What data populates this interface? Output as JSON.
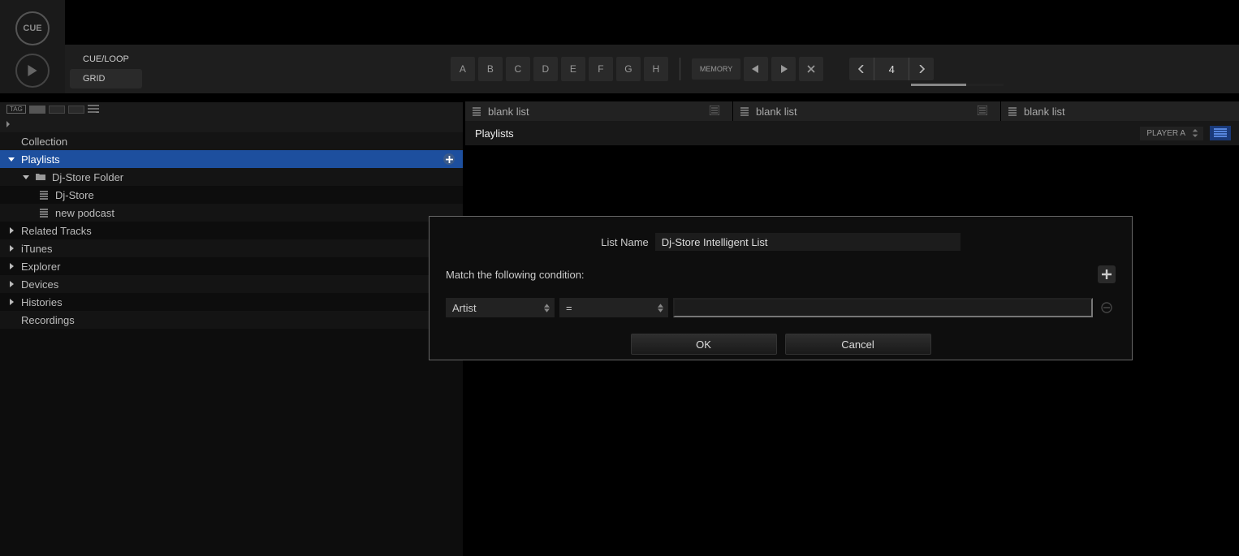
{
  "topleft": {
    "cue": "CUE"
  },
  "toolbar": {
    "tabs": {
      "cue_loop": "CUE/LOOP",
      "grid": "GRID"
    },
    "hotcues": [
      "A",
      "B",
      "C",
      "D",
      "E",
      "F",
      "G",
      "H"
    ],
    "memory_label": "MEMORY",
    "beat_count": "4"
  },
  "tagbar": {
    "tag": "TAG"
  },
  "tree": {
    "collection": "Collection",
    "playlists": "Playlists",
    "dj_store_folder": "Dj-Store Folder",
    "dj_store": "Dj-Store",
    "new_podcast": "new podcast",
    "related": "Related Tracks",
    "itunes": "iTunes",
    "explorer": "Explorer",
    "devices": "Devices",
    "histories": "Histories",
    "recordings": "Recordings"
  },
  "panels": {
    "blank1": "blank list",
    "blank2": "blank list",
    "blank3": "blank list"
  },
  "subhdr": {
    "title": "Playlists",
    "player": "PLAYER A"
  },
  "dialog": {
    "list_name_label": "List Name",
    "list_name_value": "Dj-Store Intelligent List",
    "match_label": "Match the following condition:",
    "field": "Artist",
    "op": "=",
    "value": "",
    "ok": "OK",
    "cancel": "Cancel"
  }
}
